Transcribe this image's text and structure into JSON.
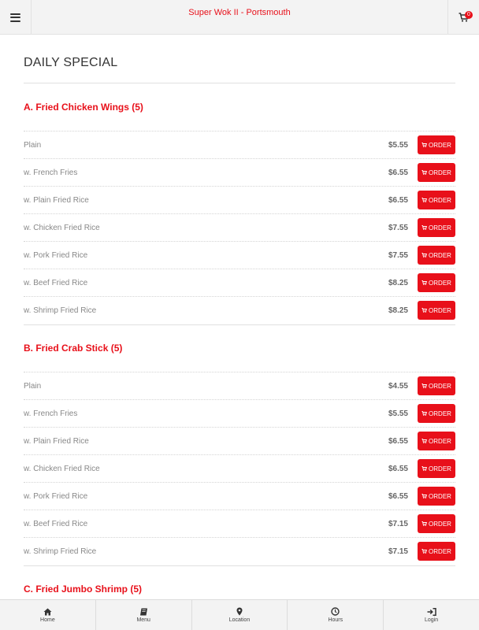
{
  "header": {
    "title": "Super Wok II - Portsmouth",
    "cart_count": "0",
    "menu_icon": "hamburger-icon",
    "cart_icon": "cart-icon"
  },
  "page": {
    "title": "DAILY SPECIAL"
  },
  "order_label": "ORDER",
  "sections": [
    {
      "title": "A. Fried Chicken Wings (5)",
      "items": [
        {
          "name": "Plain",
          "price": "$5.55"
        },
        {
          "name": "w. French Fries",
          "price": "$6.55"
        },
        {
          "name": "w. Plain Fried Rice",
          "price": "$6.55"
        },
        {
          "name": "w. Chicken Fried Rice",
          "price": "$7.55"
        },
        {
          "name": "w. Pork Fried Rice",
          "price": "$7.55"
        },
        {
          "name": "w. Beef Fried Rice",
          "price": "$8.25"
        },
        {
          "name": "w. Shrimp Fried Rice",
          "price": "$8.25"
        }
      ]
    },
    {
      "title": "B. Fried Crab Stick (5)",
      "items": [
        {
          "name": "Plain",
          "price": "$4.55"
        },
        {
          "name": "w. French Fries",
          "price": "$5.55"
        },
        {
          "name": "w. Plain Fried Rice",
          "price": "$6.55"
        },
        {
          "name": "w. Chicken Fried Rice",
          "price": "$6.55"
        },
        {
          "name": "w. Pork Fried Rice",
          "price": "$6.55"
        },
        {
          "name": "w. Beef Fried Rice",
          "price": "$7.15"
        },
        {
          "name": "w. Shrimp Fried Rice",
          "price": "$7.15"
        }
      ]
    },
    {
      "title": "C. Fried Jumbo Shrimp (5)",
      "items": []
    }
  ],
  "nav": {
    "home": "Home",
    "menu": "Menu",
    "location": "Location",
    "hours": "Hours",
    "login": "Login"
  },
  "colors": {
    "accent": "#e8101a",
    "bar_bg": "#f3f3f3"
  }
}
